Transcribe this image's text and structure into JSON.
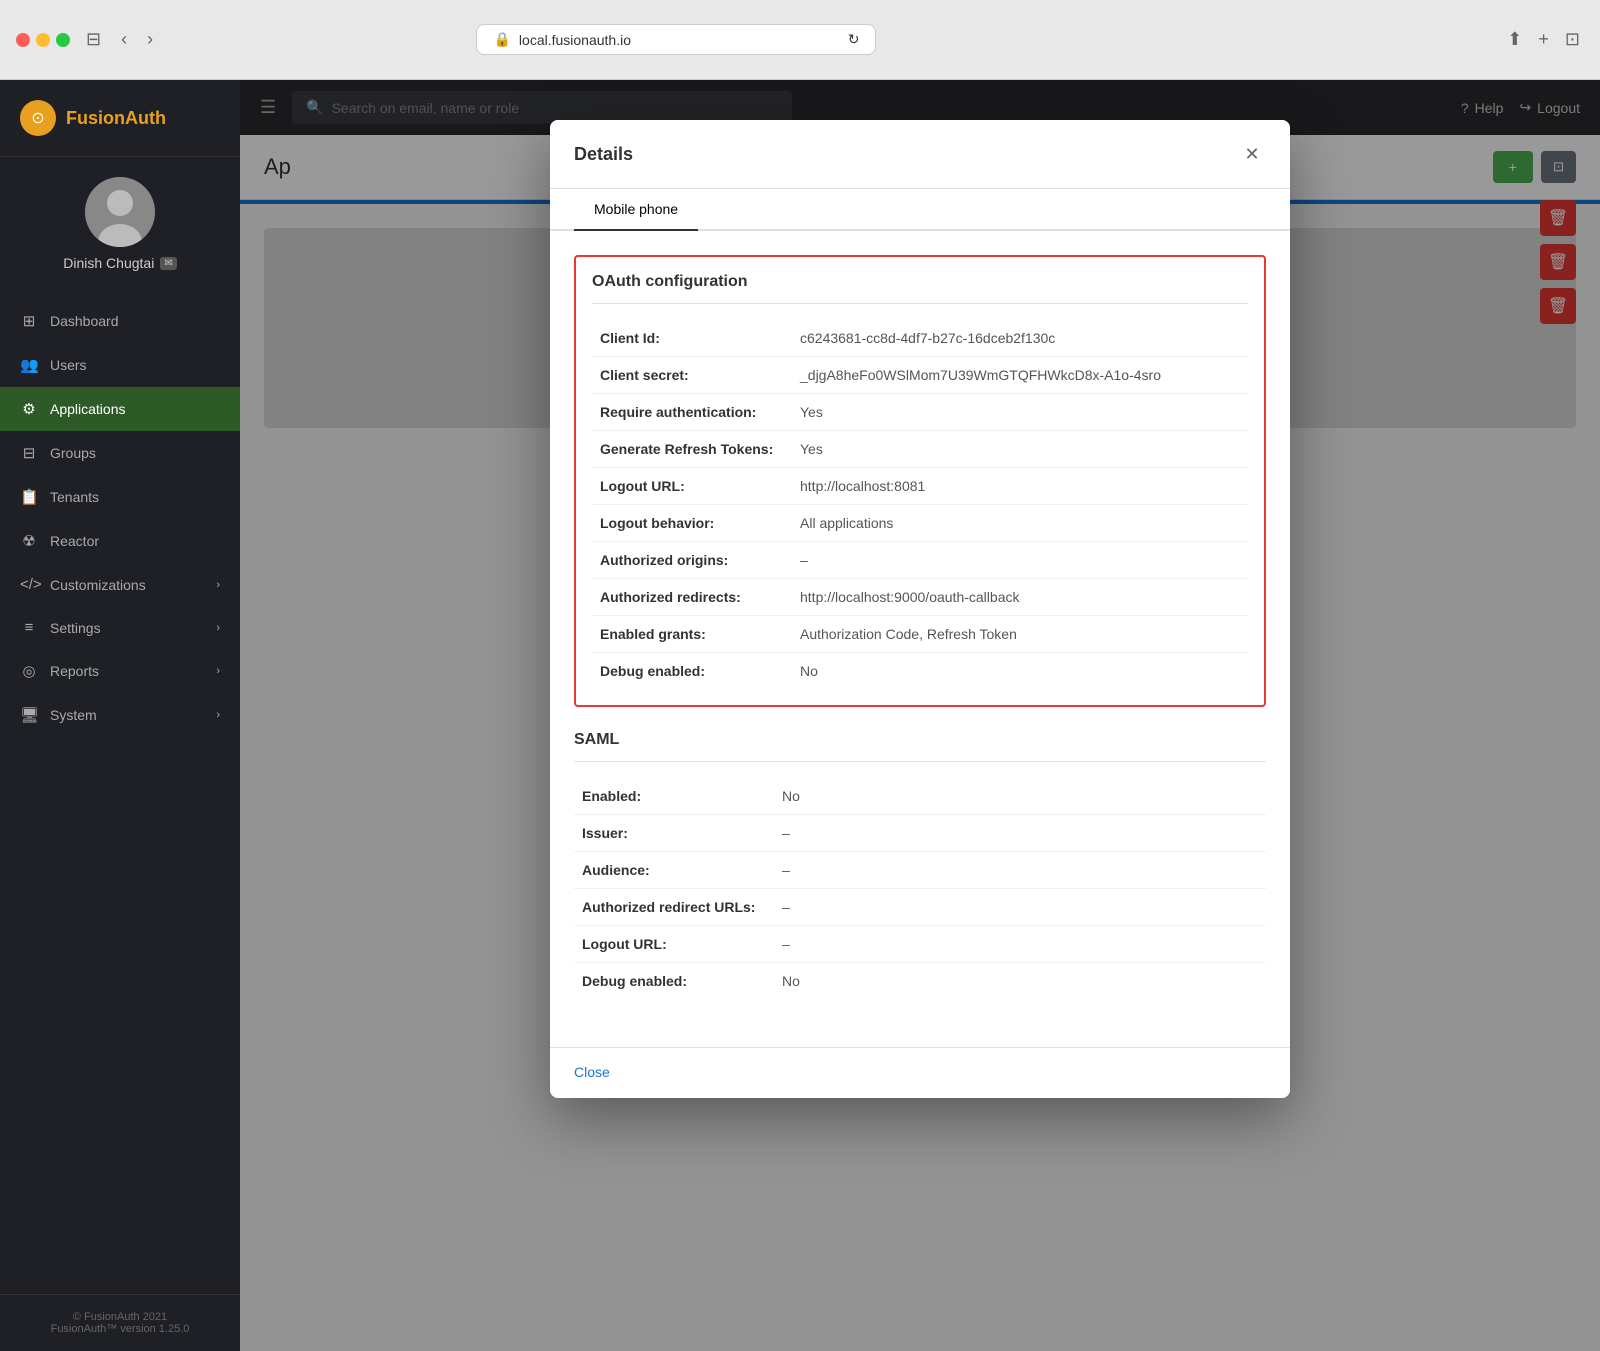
{
  "browser": {
    "url": "local.fusionauth.io",
    "tab_icon": "🔒"
  },
  "app": {
    "logo": "FusionAuth",
    "logo_icon": "⊙"
  },
  "user": {
    "name": "Dinish Chugtai",
    "badge": "📧"
  },
  "sidebar": {
    "items": [
      {
        "id": "dashboard",
        "label": "Dashboard",
        "icon": "⊞",
        "active": false
      },
      {
        "id": "users",
        "label": "Users",
        "icon": "👥",
        "active": false
      },
      {
        "id": "applications",
        "label": "Applications",
        "icon": "⚙",
        "active": true
      },
      {
        "id": "groups",
        "label": "Groups",
        "icon": "⊟",
        "active": false
      },
      {
        "id": "tenants",
        "label": "Tenants",
        "icon": "📋",
        "active": false
      },
      {
        "id": "reactor",
        "label": "Reactor",
        "icon": "☢",
        "active": false
      },
      {
        "id": "customizations",
        "label": "Customizations",
        "icon": "</>",
        "active": false,
        "has_arrow": true
      },
      {
        "id": "settings",
        "label": "Settings",
        "icon": "≡",
        "active": false,
        "has_arrow": true
      },
      {
        "id": "reports",
        "label": "Reports",
        "icon": "◎",
        "active": false,
        "has_arrow": true
      },
      {
        "id": "system",
        "label": "System",
        "icon": "🖥",
        "active": false,
        "has_arrow": true
      }
    ]
  },
  "footer": {
    "line1": "© FusionAuth 2021",
    "line2": "FusionAuth™ version 1.25.0"
  },
  "topbar": {
    "search_placeholder": "Search on email, name or role",
    "help_label": "Help",
    "logout_label": "Logout"
  },
  "page": {
    "title": "Ap"
  },
  "modal": {
    "title": "Details",
    "close_icon": "✕",
    "tab_label": "Mobile phone",
    "oauth_section": {
      "title": "OAuth configuration",
      "fields": [
        {
          "label": "Client Id:",
          "value": "c6243681-cc8d-4df7-b27c-16dceb2f130c"
        },
        {
          "label": "Client secret:",
          "value": "_djgA8heFo0WSlMom7U39WmGTQFHWkcD8x-A1o-4sro"
        },
        {
          "label": "Require authentication:",
          "value": "Yes"
        },
        {
          "label": "Generate Refresh Tokens:",
          "value": "Yes"
        },
        {
          "label": "Logout URL:",
          "value": "http://localhost:8081"
        },
        {
          "label": "Logout behavior:",
          "value": "All applications"
        },
        {
          "label": "Authorized origins:",
          "value": "–"
        },
        {
          "label": "Authorized redirects:",
          "value": "http://localhost:9000/oauth-callback"
        },
        {
          "label": "Enabled grants:",
          "value": "Authorization Code, Refresh Token"
        },
        {
          "label": "Debug enabled:",
          "value": "No"
        }
      ]
    },
    "saml_section": {
      "title": "SAML",
      "fields": [
        {
          "label": "Enabled:",
          "value": "No"
        },
        {
          "label": "Issuer:",
          "value": "–"
        },
        {
          "label": "Audience:",
          "value": "–"
        },
        {
          "label": "Authorized redirect URLs:",
          "value": "–"
        },
        {
          "label": "Logout URL:",
          "value": "–"
        },
        {
          "label": "Debug enabled:",
          "value": "No"
        }
      ]
    },
    "footer_link": "Close"
  },
  "action_buttons": [
    {
      "icon": "🗑",
      "type": "delete"
    },
    {
      "icon": "🗑",
      "type": "delete"
    },
    {
      "icon": "🗑",
      "type": "delete"
    }
  ]
}
